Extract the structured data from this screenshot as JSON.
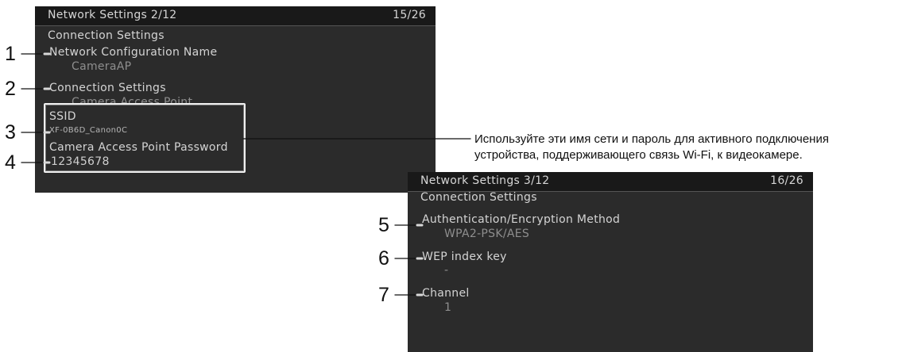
{
  "top_screen": {
    "title": "Network Settings 2/12",
    "page": "15/26",
    "section": "Connection Settings",
    "items": [
      {
        "label": "Network Configuration Name",
        "value": "CameraAP"
      },
      {
        "label": "Connection Settings",
        "value": "Camera Access Point"
      },
      {
        "label": "SSID",
        "value": "XF-0B6D_Canon0C"
      },
      {
        "label": "Camera Access Point Password",
        "value": "12345678"
      }
    ]
  },
  "bottom_screen": {
    "title": "Network Settings 3/12",
    "page": "16/26",
    "section": "Connection Settings",
    "items": [
      {
        "label": "Authentication/Encryption Method",
        "value": "WPA2-PSK/AES"
      },
      {
        "label": "WEP index key",
        "value": "-"
      },
      {
        "label": "Channel",
        "value": "1"
      }
    ]
  },
  "callouts": [
    "1",
    "2",
    "3",
    "4",
    "5",
    "6",
    "7"
  ],
  "note": {
    "line1": "Используйте эти имя сети и пароль для активного подключения",
    "line2": "устройства, поддерживающего связь Wi-Fi, к видеокамере."
  }
}
